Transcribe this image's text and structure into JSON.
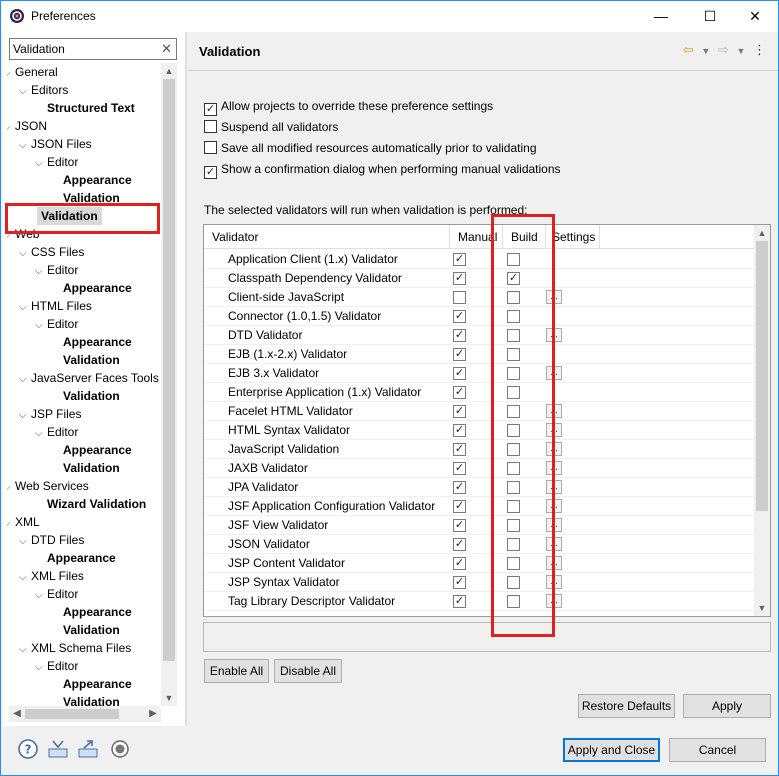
{
  "window": {
    "title": "Preferences"
  },
  "titlebar": {
    "minimize": "—",
    "maximize": "☐",
    "close": "✕"
  },
  "filter": {
    "value": "Validation",
    "clear_icon": "clear-icon"
  },
  "tree": [
    {
      "label": "General",
      "indent": 0,
      "arrow": "v",
      "bold": false
    },
    {
      "label": "Editors",
      "indent": 1,
      "arrow": "v",
      "bold": false
    },
    {
      "label": "Structured Text",
      "indent": 2,
      "arrow": "",
      "bold": true
    },
    {
      "label": "JSON",
      "indent": 0,
      "arrow": "v",
      "bold": false
    },
    {
      "label": "JSON Files",
      "indent": 1,
      "arrow": "v",
      "bold": false
    },
    {
      "label": "Editor",
      "indent": 2,
      "arrow": "v",
      "bold": false
    },
    {
      "label": "Appearance",
      "indent": 3,
      "arrow": "",
      "bold": true
    },
    {
      "label": "Validation",
      "indent": 3,
      "arrow": "",
      "bold": true
    },
    {
      "label": "Validation",
      "indent": 1,
      "arrow": "",
      "bold": true,
      "selected": true
    },
    {
      "label": "Web",
      "indent": 0,
      "arrow": "v",
      "bold": false
    },
    {
      "label": "CSS Files",
      "indent": 1,
      "arrow": "v",
      "bold": false
    },
    {
      "label": "Editor",
      "indent": 2,
      "arrow": "v",
      "bold": false
    },
    {
      "label": "Appearance",
      "indent": 3,
      "arrow": "",
      "bold": true
    },
    {
      "label": "HTML Files",
      "indent": 1,
      "arrow": "v",
      "bold": false
    },
    {
      "label": "Editor",
      "indent": 2,
      "arrow": "v",
      "bold": false
    },
    {
      "label": "Appearance",
      "indent": 3,
      "arrow": "",
      "bold": true
    },
    {
      "label": "Validation",
      "indent": 3,
      "arrow": "",
      "bold": true
    },
    {
      "label": "JavaServer Faces Tools",
      "indent": 1,
      "arrow": "v",
      "bold": false
    },
    {
      "label": "Validation",
      "indent": 3,
      "arrow": "",
      "bold": true
    },
    {
      "label": "JSP Files",
      "indent": 1,
      "arrow": "v",
      "bold": false
    },
    {
      "label": "Editor",
      "indent": 2,
      "arrow": "v",
      "bold": false
    },
    {
      "label": "Appearance",
      "indent": 3,
      "arrow": "",
      "bold": true
    },
    {
      "label": "Validation",
      "indent": 3,
      "arrow": "",
      "bold": true
    },
    {
      "label": "Web Services",
      "indent": 0,
      "arrow": "v",
      "bold": false
    },
    {
      "label": "Wizard Validation",
      "indent": 2,
      "arrow": "",
      "bold": true
    },
    {
      "label": "XML",
      "indent": 0,
      "arrow": "v",
      "bold": false
    },
    {
      "label": "DTD Files",
      "indent": 1,
      "arrow": "v",
      "bold": false
    },
    {
      "label": "Appearance",
      "indent": 2,
      "arrow": "",
      "bold": true
    },
    {
      "label": "XML Files",
      "indent": 1,
      "arrow": "v",
      "bold": false
    },
    {
      "label": "Editor",
      "indent": 2,
      "arrow": "v",
      "bold": false
    },
    {
      "label": "Appearance",
      "indent": 3,
      "arrow": "",
      "bold": true
    },
    {
      "label": "Validation",
      "indent": 3,
      "arrow": "",
      "bold": true
    },
    {
      "label": "XML Schema Files",
      "indent": 1,
      "arrow": "v",
      "bold": false
    },
    {
      "label": "Editor",
      "indent": 2,
      "arrow": "v",
      "bold": false
    },
    {
      "label": "Appearance",
      "indent": 3,
      "arrow": "",
      "bold": true
    },
    {
      "label": "Validation",
      "indent": 3,
      "arrow": "",
      "bold": true
    }
  ],
  "page": {
    "title": "Validation",
    "nav": {
      "back_icon": "back-arrow-icon",
      "forward_icon": "forward-arrow-icon",
      "menu_icon": "kebab-menu-icon"
    },
    "options": [
      {
        "label": "Allow projects to override these preference settings",
        "checked": true
      },
      {
        "label": "Suspend all validators",
        "checked": false
      },
      {
        "label": "Save all modified resources automatically prior to validating",
        "checked": false
      },
      {
        "label": "Show a confirmation dialog when performing manual validations",
        "checked": true
      }
    ],
    "info": "The selected validators will run when validation is performed:",
    "columns": [
      "Validator",
      "Manual",
      "Build",
      "Settings"
    ],
    "validators": [
      {
        "name": "Application Client (1.x) Validator",
        "manual": true,
        "build": false,
        "settings": false
      },
      {
        "name": "Classpath Dependency Validator",
        "manual": true,
        "build": true,
        "settings": false
      },
      {
        "name": "Client-side JavaScript",
        "manual": false,
        "build": false,
        "settings": true
      },
      {
        "name": "Connector (1.0,1.5) Validator",
        "manual": true,
        "build": false,
        "settings": false
      },
      {
        "name": "DTD Validator",
        "manual": true,
        "build": false,
        "settings": true
      },
      {
        "name": "EJB (1.x-2.x) Validator",
        "manual": true,
        "build": false,
        "settings": false
      },
      {
        "name": "EJB 3.x Validator",
        "manual": true,
        "build": false,
        "settings": true
      },
      {
        "name": "Enterprise Application (1.x) Validator",
        "manual": true,
        "build": false,
        "settings": false
      },
      {
        "name": "Facelet HTML Validator",
        "manual": true,
        "build": false,
        "settings": true
      },
      {
        "name": "HTML Syntax Validator",
        "manual": true,
        "build": false,
        "settings": true
      },
      {
        "name": "JavaScript Validation",
        "manual": true,
        "build": false,
        "settings": true
      },
      {
        "name": "JAXB Validator",
        "manual": true,
        "build": false,
        "settings": true
      },
      {
        "name": "JPA Validator",
        "manual": true,
        "build": false,
        "settings": true
      },
      {
        "name": "JSF Application Configuration Validator",
        "manual": true,
        "build": false,
        "settings": true
      },
      {
        "name": "JSF View Validator",
        "manual": true,
        "build": false,
        "settings": true
      },
      {
        "name": "JSON Validator",
        "manual": true,
        "build": false,
        "settings": true
      },
      {
        "name": "JSP Content Validator",
        "manual": true,
        "build": false,
        "settings": true
      },
      {
        "name": "JSP Syntax Validator",
        "manual": true,
        "build": false,
        "settings": true
      },
      {
        "name": "Tag Library Descriptor Validator",
        "manual": true,
        "build": false,
        "settings": true
      }
    ],
    "settings_label": "...",
    "buttons": {
      "enable_all": "Enable All",
      "disable_all": "Disable All",
      "restore_defaults": "Restore Defaults",
      "apply": "Apply"
    }
  },
  "footer": {
    "apply_close": "Apply and Close",
    "cancel": "Cancel",
    "icons": [
      "help-icon",
      "import-icon",
      "export-icon",
      "record-icon"
    ]
  },
  "colors": {
    "highlight": "#e02020",
    "accent": "#0078d7"
  }
}
